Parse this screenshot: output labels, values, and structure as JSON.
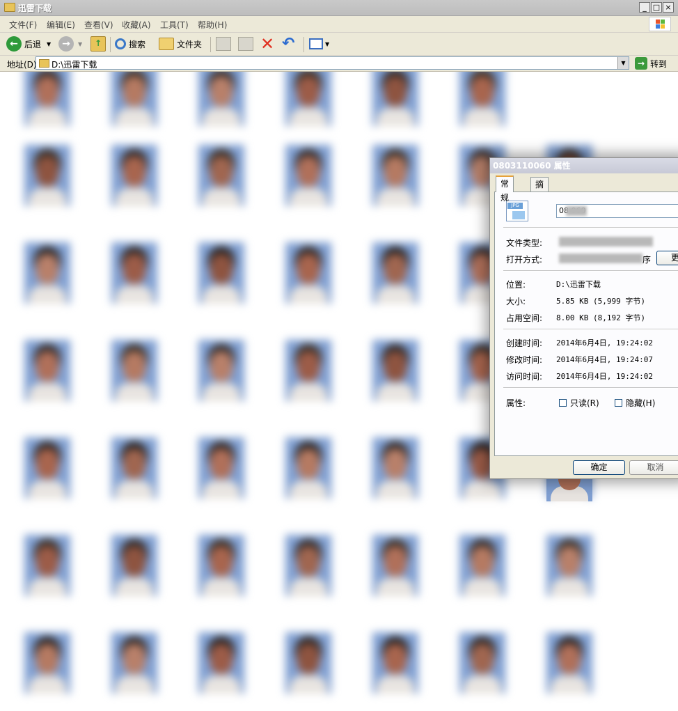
{
  "window": {
    "title": "迅雷下载"
  },
  "caption_buttons": {
    "minimize": "_",
    "maximize": "□",
    "close": "×"
  },
  "menu": [
    "文件(F)",
    "编辑(E)",
    "查看(V)",
    "收藏(A)",
    "工具(T)",
    "帮助(H)"
  ],
  "toolbar": {
    "back_label": "后退",
    "search_label": "搜索",
    "folders_label": "文件夹"
  },
  "address": {
    "label": "地址(D)",
    "value": "D:\\迅雷下载",
    "go_label": "转到"
  },
  "dialog": {
    "title": "0803110060 属性",
    "tabs": [
      "常规",
      "摘要"
    ],
    "filename": "08      060",
    "file_type_label": "文件类型:",
    "open_with_label": "打开方式:",
    "open_with_suffix": "序",
    "change_button": "更",
    "location_label": "位置:",
    "location_value": "D:\\迅雷下载",
    "size_label": "大小:",
    "size_value": "5.85 KB (5,999 字节)",
    "disk_size_label": "占用空间:",
    "disk_size_value": "8.00 KB (8,192 字节)",
    "created_label": "创建时间:",
    "created_value": "2014年6月4日, 19:24:02",
    "modified_label": "修改时间:",
    "modified_value": "2014年6月4日, 19:24:07",
    "accessed_label": "访问时间:",
    "accessed_value": "2014年6月4日, 19:24:02",
    "attributes_label": "属性:",
    "readonly_label": "只读(R)",
    "hidden_label": "隐藏(H)",
    "ok_button": "确定",
    "cancel_button": "取消"
  },
  "colors": {
    "photo_background": "#7f9fd2",
    "dialog_face": "#ece9d8",
    "tab_highlight": "#e6a23a"
  }
}
